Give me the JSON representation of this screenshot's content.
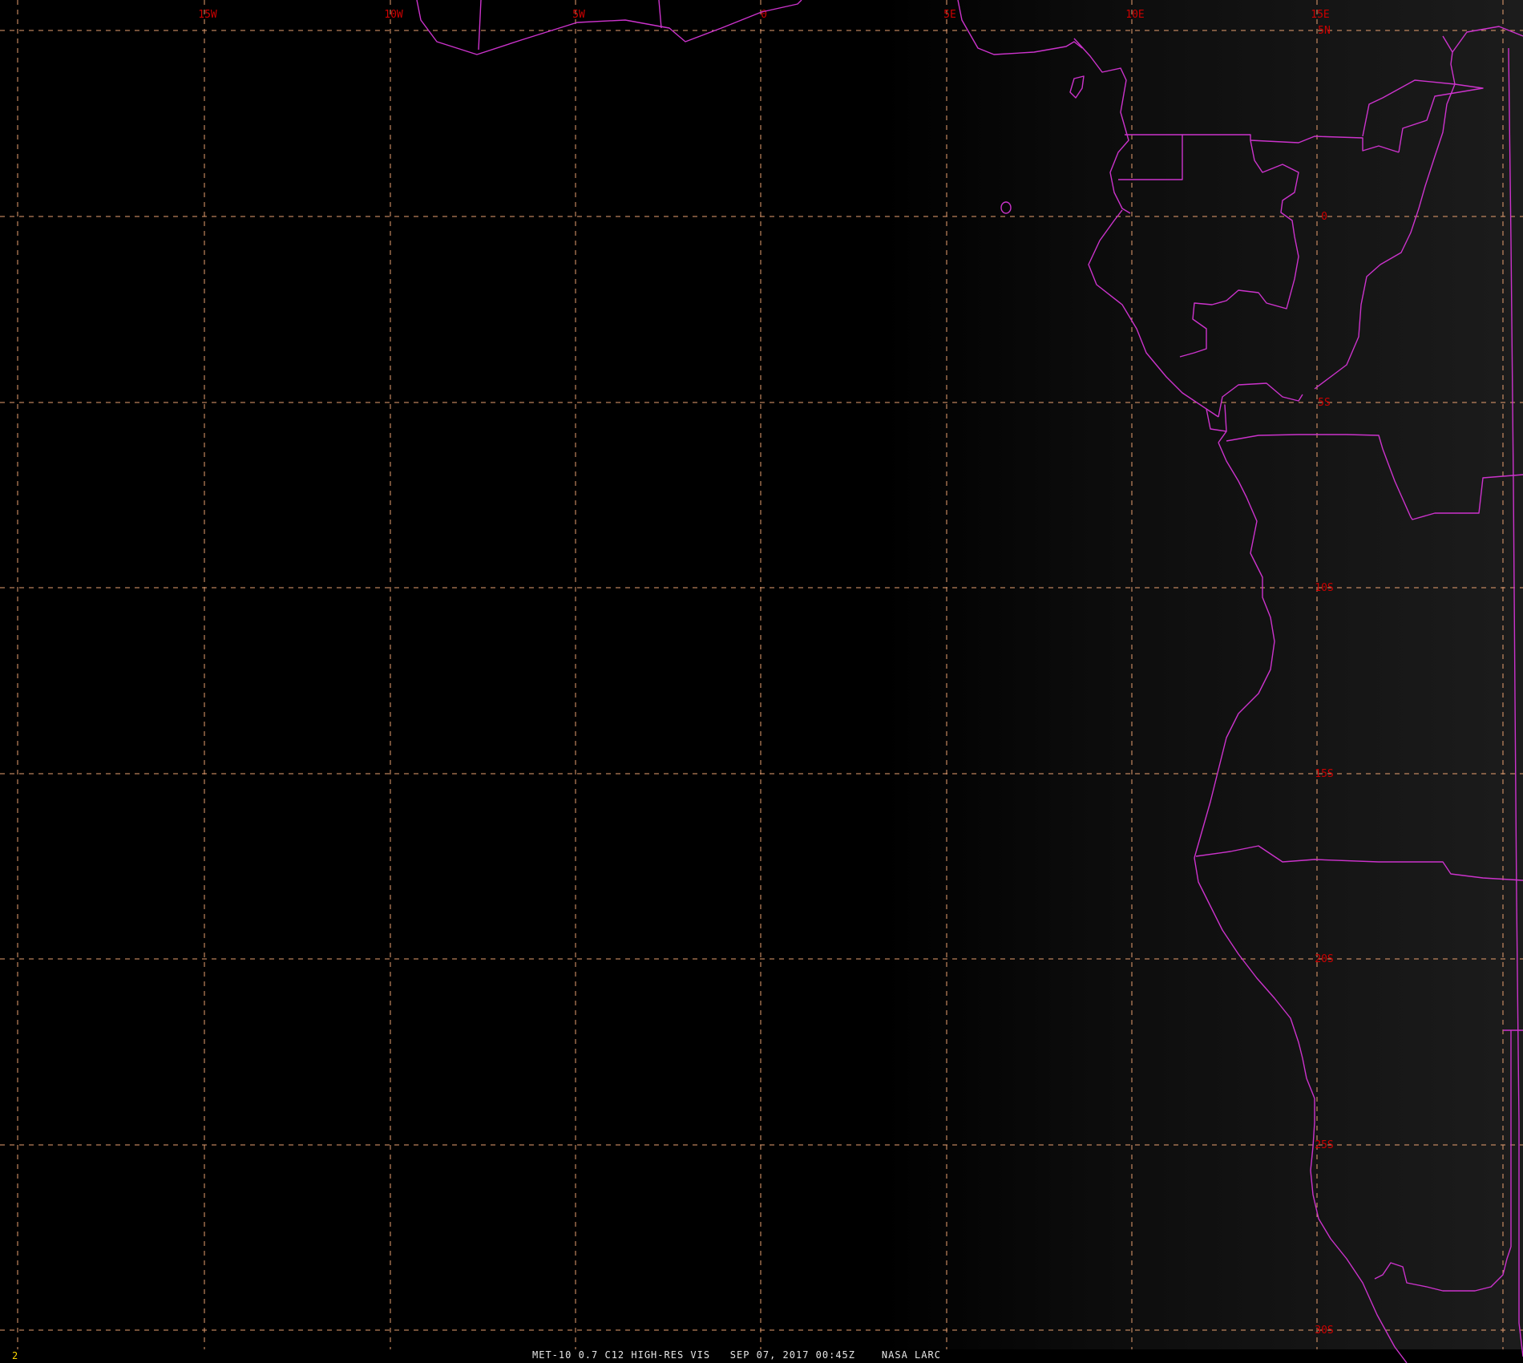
{
  "colors": {
    "background": "#000000",
    "gridline": "#e8a070",
    "grid_label": "#cc0000",
    "coastline": "#cc33cc",
    "caption": "#e6e6e6",
    "frame_number": "#ffd700"
  },
  "grid": {
    "style": "dashed",
    "lon_labels": [
      "15W",
      "10W",
      "5W",
      "0",
      "5E",
      "10E",
      "15E"
    ],
    "lat_labels": [
      "5N",
      "0",
      "5S",
      "10S",
      "15S",
      "20S",
      "25S",
      "30S"
    ]
  },
  "footer": {
    "frame_number": "2",
    "caption": "MET-10 0.7 C12 HIGH-RES VIS   SEP 07, 2017 00:45Z    NASA LARC"
  }
}
